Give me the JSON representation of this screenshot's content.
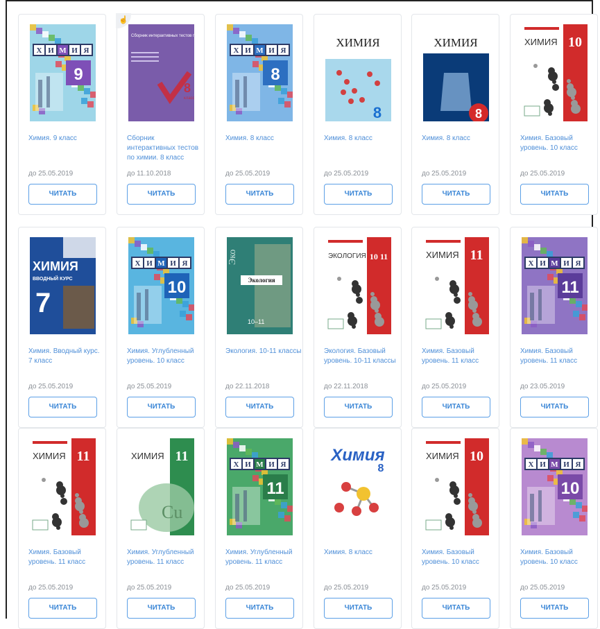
{
  "books": [
    {
      "title": "Химия. 9 класс",
      "date": "до 25.05.2019",
      "button": "ЧИТАТЬ",
      "cover": {
        "style": "mosaic",
        "grade": "9",
        "bg": "#9ed6e8",
        "accent": "#7e4fb7"
      }
    },
    {
      "title": "Сборник интерактивных тестов по химии. 8 класс",
      "date": "до 11.10.2018",
      "button": "ЧИТАТЬ",
      "cover": {
        "style": "tests",
        "grade": "8",
        "bg": "#7a5caa",
        "accent": "#c23046",
        "cover_title": "Сборник интерактивных тестов по Химии",
        "cover_sub": "класс"
      }
    },
    {
      "title": "Химия. 8 класс",
      "date": "до 25.05.2019",
      "button": "ЧИТАТЬ",
      "cover": {
        "style": "mosaic",
        "grade": "8",
        "bg": "#7fb6e6",
        "accent": "#2d6fc1"
      }
    },
    {
      "title": "Химия. 8 класс",
      "date": "до 25.05.2019",
      "button": "ЧИТАТЬ",
      "cover": {
        "style": "white",
        "grade": "8",
        "bg": "#ffffff",
        "accent": "#1a6fd0",
        "word": "ХИМИЯ"
      }
    },
    {
      "title": "Химия. 8 класс",
      "date": "до 25.05.2019",
      "button": "ЧИТАТЬ",
      "cover": {
        "style": "white-dark",
        "grade": "8",
        "bg": "#ffffff",
        "accent": "#d42a2a",
        "word": "ХИМИЯ"
      }
    },
    {
      "title": "Химия. Базовый уровень. 10 класс",
      "date": "до 25.05.2019",
      "button": "ЧИТАТЬ",
      "cover": {
        "style": "redband",
        "grade": "10",
        "bg": "#ffffff",
        "accent": "#d12b2b",
        "word": "ХИМИЯ"
      }
    },
    {
      "title": "Химия. Вводный курс. 7 класс",
      "date": "до 25.05.2019",
      "button": "ЧИТАТЬ",
      "cover": {
        "style": "blue7",
        "grade": "7",
        "bg": "#1f4e9a",
        "accent": "#ffffff",
        "word": "ХИМИЯ",
        "sub": "ВВОДНЫЙ КУРС"
      }
    },
    {
      "title": "Химия. Углубленный уровень. 10 класс",
      "date": "до 25.05.2019",
      "button": "ЧИТАТЬ",
      "cover": {
        "style": "mosaic",
        "grade": "10",
        "bg": "#59b5e0",
        "accent": "#1e63b8"
      }
    },
    {
      "title": "Экология. 10-11 классы",
      "date": "до 22.11.2018",
      "button": "ЧИТАТЬ",
      "cover": {
        "style": "ecology",
        "grade": "10–11",
        "bg": "#2f7f76",
        "accent": "#ffffff",
        "word": "Экология"
      }
    },
    {
      "title": "Экология. Базовый уровень. 10-11 классы",
      "date": "до 22.11.2018",
      "button": "ЧИТАТЬ",
      "cover": {
        "style": "redband",
        "grade": "10 11",
        "bg": "#ffffff",
        "accent": "#d12b2b",
        "word": "ЭКОЛОГИЯ"
      }
    },
    {
      "title": "Химия. Базовый уровень. 11 класс",
      "date": "до 25.05.2019",
      "button": "ЧИТАТЬ",
      "cover": {
        "style": "redband",
        "grade": "11",
        "bg": "#ffffff",
        "accent": "#d12b2b",
        "word": "ХИМИЯ"
      }
    },
    {
      "title": "Химия. Базовый уровень. 11 класс",
      "date": "до 23.05.2019",
      "button": "ЧИТАТЬ",
      "cover": {
        "style": "mosaic",
        "grade": "11",
        "bg": "#8f74c4",
        "accent": "#5b3c9a"
      }
    },
    {
      "title": "Химия. Базовый уровень. 11 класс",
      "date": "до 25.05.2019",
      "button": "ЧИТАТЬ",
      "cover": {
        "style": "redband",
        "grade": "11",
        "bg": "#ffffff",
        "accent": "#d12b2b",
        "word": "ХИМИЯ"
      }
    },
    {
      "title": "Химия. Углубленный уровень. 11 класс",
      "date": "до 25.05.2019",
      "button": "ЧИТАТЬ",
      "cover": {
        "style": "greenband",
        "grade": "11",
        "bg": "#ffffff",
        "accent": "#2e8d4f",
        "word": "ХИМИЯ"
      }
    },
    {
      "title": "Химия. Углубленный уровень. 11 класс",
      "date": "до 25.05.2019",
      "button": "ЧИТАТЬ",
      "cover": {
        "style": "mosaic",
        "grade": "11",
        "bg": "#4aa86a",
        "accent": "#2a7d4a"
      }
    },
    {
      "title": "Химия. 8 класс",
      "date": "до 25.05.2019",
      "button": "ЧИТАТЬ",
      "cover": {
        "style": "bigword",
        "grade": "8",
        "bg": "#ffffff",
        "accent": "#2a62c4",
        "word": "Химия"
      }
    },
    {
      "title": "Химия. Базовый уровень. 10 класс",
      "date": "до 25.05.2019",
      "button": "ЧИТАТЬ",
      "cover": {
        "style": "redband",
        "grade": "10",
        "bg": "#ffffff",
        "accent": "#d12b2b",
        "word": "ХИМИЯ"
      }
    },
    {
      "title": "Химия. Базовый уровень. 10 класс",
      "date": "до 25.05.2019",
      "button": "ЧИТАТЬ",
      "cover": {
        "style": "mosaic",
        "grade": "10",
        "bg": "#b88ad0",
        "accent": "#7a4aa8"
      }
    }
  ]
}
